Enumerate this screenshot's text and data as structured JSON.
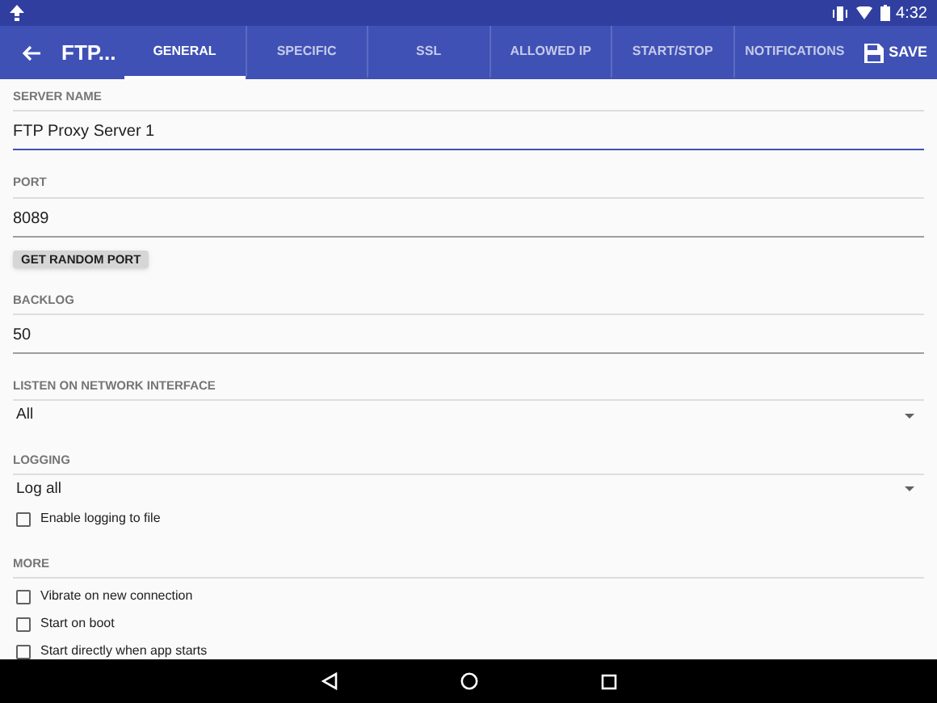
{
  "status_bar": {
    "time": "4:32"
  },
  "toolbar": {
    "title": "FTP...",
    "save_label": "SAVE"
  },
  "tabs": [
    {
      "label": "GENERAL",
      "selected": true
    },
    {
      "label": "SPECIFIC",
      "selected": false
    },
    {
      "label": "SSL",
      "selected": false
    },
    {
      "label": "ALLOWED IP",
      "selected": false
    },
    {
      "label": "START/STOP",
      "selected": false
    },
    {
      "label": "NOTIFICATIONS",
      "selected": false
    }
  ],
  "form": [
    {
      "kind": "field",
      "label": "SERVER NAME",
      "value": "FTP Proxy Server 1",
      "focused": true
    },
    {
      "kind": "field",
      "label": "PORT",
      "value": "8089",
      "focused": false
    },
    {
      "kind": "button",
      "label": "GET RANDOM PORT"
    },
    {
      "kind": "field",
      "label": "BACKLOG",
      "value": "50",
      "focused": false
    },
    {
      "kind": "dropdown",
      "label": "LISTEN ON NETWORK INTERFACE",
      "value": "All"
    },
    {
      "kind": "dropdown",
      "label": "LOGGING",
      "value": "Log all"
    },
    {
      "kind": "checkbox",
      "label": "Enable logging to file",
      "checked": false
    },
    {
      "kind": "header",
      "label": "MORE"
    },
    {
      "kind": "checkbox",
      "label": "Vibrate on new connection",
      "checked": false
    },
    {
      "kind": "checkbox",
      "label": "Start on boot",
      "checked": false
    },
    {
      "kind": "checkbox",
      "label": "Start directly when app starts",
      "checked": false
    }
  ]
}
